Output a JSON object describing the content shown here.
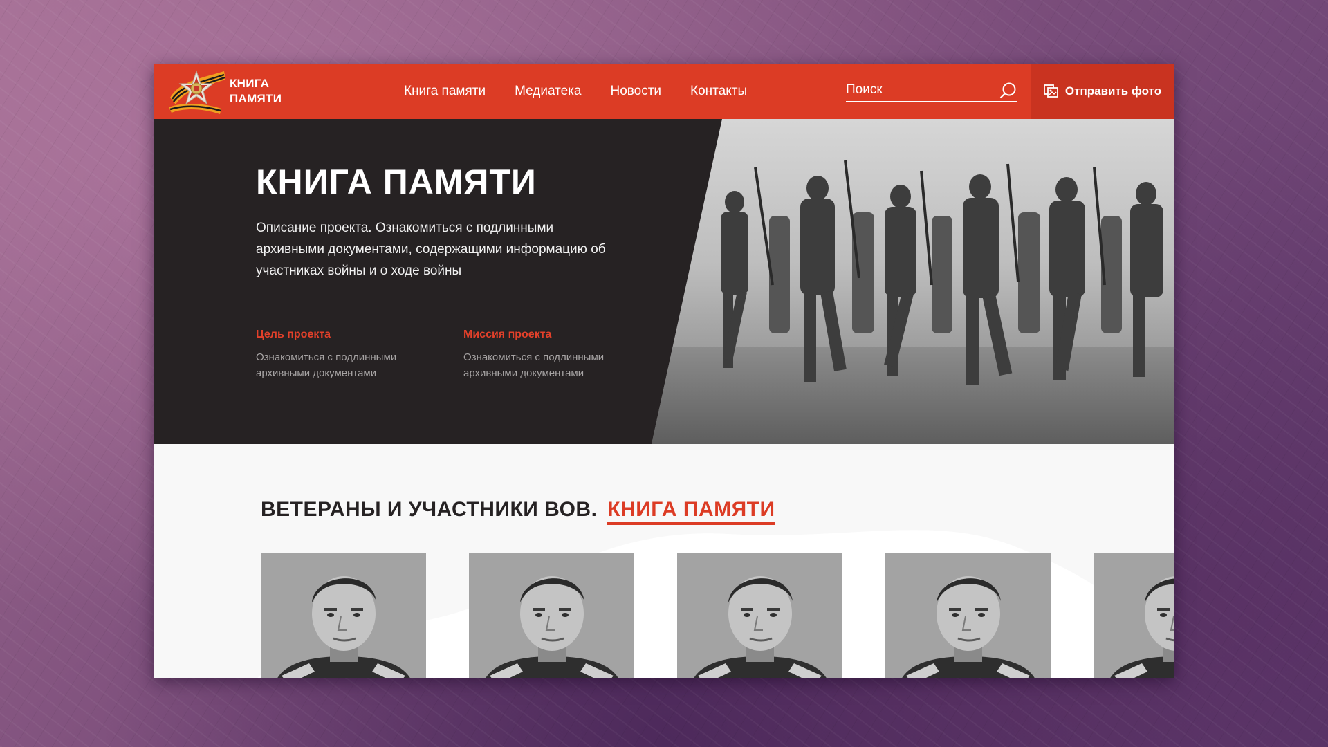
{
  "header": {
    "logo_line1": "КНИГА",
    "logo_line2": "ПАМЯТИ",
    "nav": [
      "Книга памяти",
      "Медиатека",
      "Новости",
      "Контакты"
    ],
    "search_placeholder": "Поиск",
    "send_photo_label": "Отправить фото"
  },
  "hero": {
    "title": "КНИГА ПАМЯТИ",
    "description": "Описание проекта. Ознакомиться с подлинными архивными документами, содержащими информацию об участниках войны и о ходе войны",
    "goal": {
      "title": "Цель проекта",
      "text": "Ознакомиться с подлинными архивными документами"
    },
    "mission": {
      "title": "Миссия проекта",
      "text": "Ознакомиться с подлинными архивными документами"
    }
  },
  "veterans": {
    "title_main": "ВЕТЕРАНЫ И УЧАСТНИКИ ВОВ.",
    "title_accent": "КНИГА ПАМЯТИ",
    "cards_count": 5
  },
  "colors": {
    "accent": "#dc3c25",
    "dark": "#262223",
    "send_photo_bg": "#c93320"
  }
}
